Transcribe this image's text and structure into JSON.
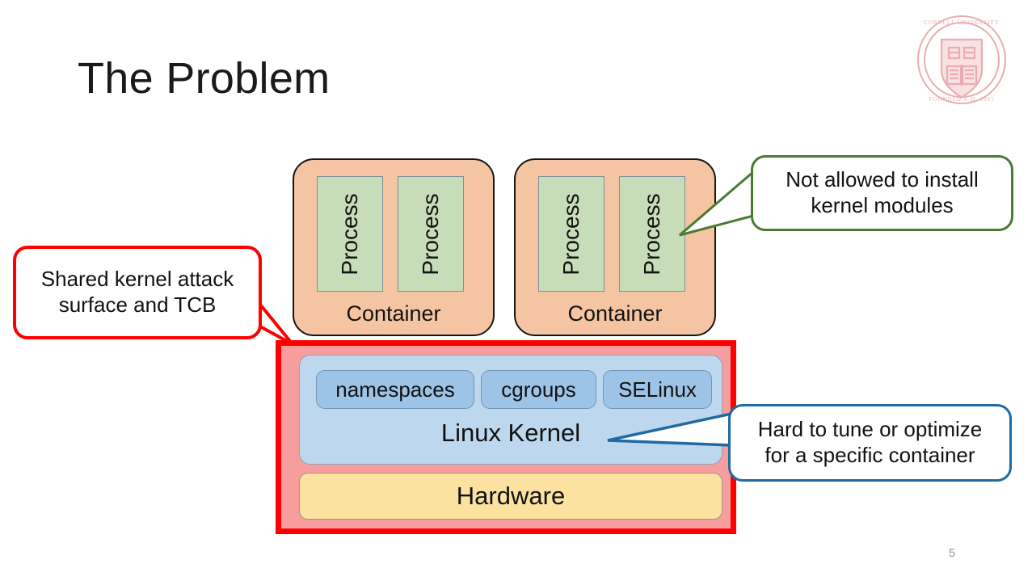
{
  "slide": {
    "title": "The Problem",
    "page_number": "5",
    "logo": "cornell-university-seal",
    "logo_text": "CORNELL UNIVERSITY FOUNDED A.D. 1865",
    "background_color": "#ffffff"
  },
  "diagram": {
    "containers": [
      {
        "label": "Container",
        "processes": [
          {
            "label": "Process"
          },
          {
            "label": "Process"
          }
        ]
      },
      {
        "label": "Container",
        "processes": [
          {
            "label": "Process"
          },
          {
            "label": "Process"
          }
        ]
      }
    ],
    "kernel": {
      "label": "Linux Kernel",
      "features": [
        {
          "label": "namespaces"
        },
        {
          "label": "cgroups"
        },
        {
          "label": "SELinux"
        }
      ]
    },
    "hardware": {
      "label": "Hardware"
    },
    "colors": {
      "container_fill": "#f5c5a3",
      "process_fill": "#c7ddb9",
      "kernel_fill": "#bdd7ee",
      "kernel_feature_fill": "#9dc3e6",
      "hardware_fill": "#fbe2a0",
      "highlight_fill": "#f79d9d",
      "highlight_border": "#ff0000"
    }
  },
  "callouts": {
    "red": {
      "line1": "Shared kernel attack",
      "line2": "surface and TCB",
      "color": "#ff0000"
    },
    "green": {
      "line1": "Not allowed to install",
      "line2": "kernel modules",
      "color": "#4a7a33"
    },
    "blue": {
      "line1": "Hard to tune or optimize",
      "line2": "for a specific container",
      "color": "#1f6aa5"
    }
  }
}
